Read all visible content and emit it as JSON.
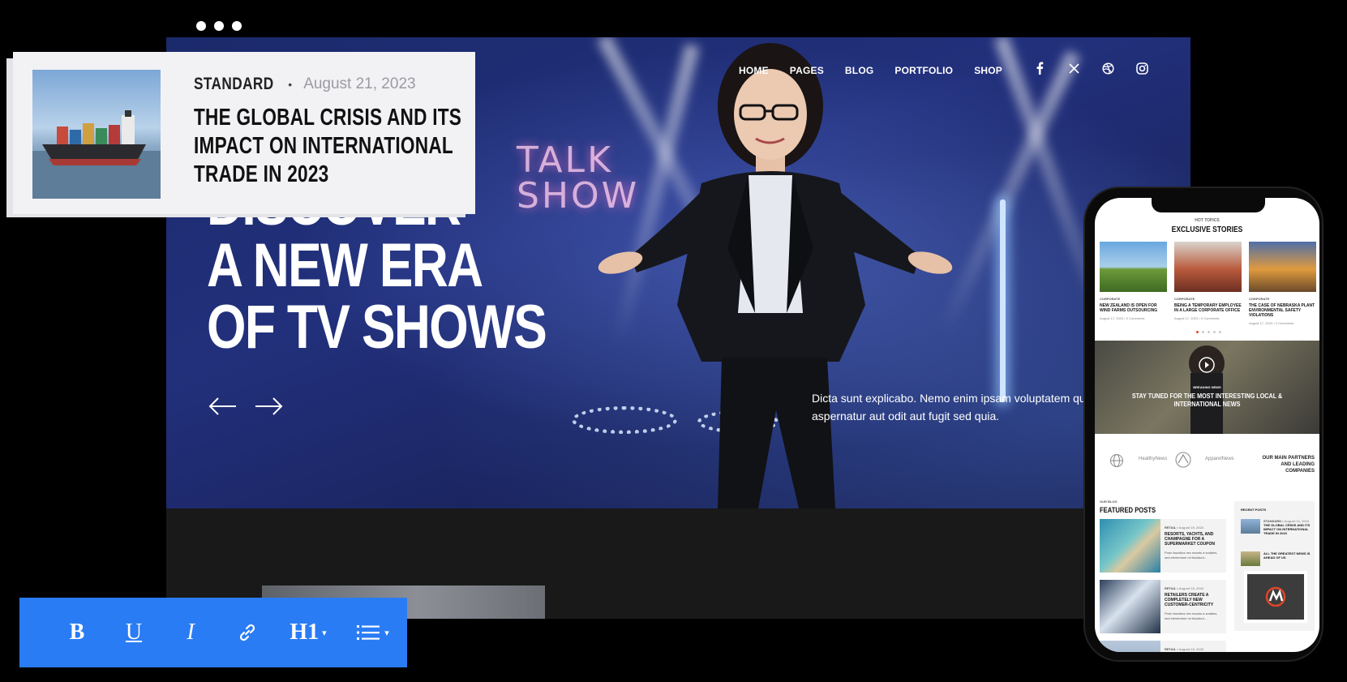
{
  "nav": {
    "items": [
      "HOME",
      "PAGES",
      "BLOG",
      "PORTFOLIO",
      "SHOP"
    ],
    "social_icons": [
      "facebook-icon",
      "x-twitter-icon",
      "dribbble-icon",
      "instagram-icon"
    ]
  },
  "hero": {
    "backdrop_sign": "TALK\nSHOW",
    "heading_line1": "DISCOVER",
    "heading_line2": "A NEW ERA",
    "heading_line3": "OF TV SHOWS",
    "text": "Dicta sunt explicabo. Nemo enim ipsam voluptatem quia voluptas sit aspernatur aut odit aut fugit sed quia."
  },
  "card": {
    "category": "STANDARD",
    "separator": "•",
    "date": "August 21, 2023",
    "title": "THE GLOBAL CRISIS AND ITS IMPACT ON INTERNATIONAL TRADE IN 2023"
  },
  "toolbar": {
    "bold": "B",
    "underline": "U",
    "italic": "I",
    "heading": "H1",
    "caret": "▾"
  },
  "phone": {
    "kicker": "HOT TOPICS",
    "title": "EXCLUSIVE STORIES",
    "stories": [
      {
        "category": "CORPORATE",
        "headline": "NEW ZEALAND IS OPEN FOR WIND FARMS OUTSOURCING",
        "meta": "August 17, 2023 • 0 Comments"
      },
      {
        "category": "CORPORATE",
        "headline": "BEING A TEMPORARY EMPLOYEE IN A LARGE CORPORATE OFFICE",
        "meta": "August 17, 2023 • 0 Comments"
      },
      {
        "category": "CORPORATE",
        "headline": "THE CASE OF NEBRASKA PLANT ENVIRONMENTAL SAFETY VIOLATIONS",
        "meta": "August 17, 2023 • 0 Comments"
      }
    ],
    "banner_kicker": "BREAKING NEWS",
    "banner_title": "STAY TUNED FOR THE MOST INTERESTING LOCAL & INTERNATIONAL NEWS",
    "partners": [
      "HealthyNews",
      "ApparelNews"
    ],
    "partners_text": "OUR MAIN PARTNERS AND LEADING COMPANIES",
    "blog_kicker": "OUR BLOG",
    "blog_title": "FEATURED POSTS",
    "posts": [
      {
        "category": "RETAIL",
        "date": "August 19, 2023",
        "headline": "RESORTS, YACHTS, AND CHAMPAGNE FOR A SUPERMARKET COUPON",
        "excerpt": "Proin faucibus nec mauris a sodales, sed elementum mi tincidunt..."
      },
      {
        "category": "RETAIL",
        "date": "August 19, 2023",
        "headline": "RETAILERS CREATE A COMPLETELY NEW CUSTOMER-CENTRICITY",
        "excerpt": "Proin faucibus nec mauris a sodales, sed elementum mi tincidunt..."
      },
      {
        "category": "RETAIL",
        "date": "August 19, 2023",
        "headline": "",
        "excerpt": ""
      }
    ],
    "recent_kicker": "RECENT POSTS",
    "recent": [
      {
        "category": "STANDARD",
        "date": "August 21, 2023",
        "headline": "THE GLOBAL CRISIS AND ITS IMPACT ON INTERNATIONAL TRADE IN 2023"
      },
      {
        "category": "",
        "date": "",
        "headline": "ALL THE GREATEST NEWS IS AHEAD OF US"
      }
    ]
  },
  "colors": {
    "toolbar_blue": "#2a7cf5",
    "hero_blue": "#22307c",
    "accent_red": "#e0452b"
  }
}
